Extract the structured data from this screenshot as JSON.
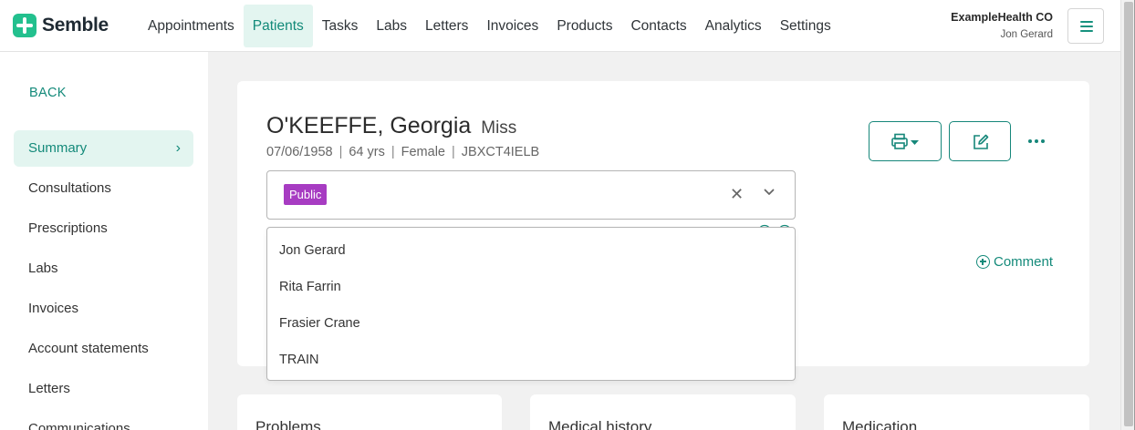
{
  "brand": {
    "name": "Semble",
    "accent": "#148a7a",
    "logo_color": "#23c08e"
  },
  "nav": {
    "items": [
      "Appointments",
      "Patients",
      "Tasks",
      "Labs",
      "Letters",
      "Invoices",
      "Products",
      "Contacts",
      "Analytics",
      "Settings"
    ],
    "active": "Patients"
  },
  "account": {
    "org": "ExampleHealth CO",
    "user": "Jon Gerard"
  },
  "sidebar": {
    "back_label": "BACK",
    "items": [
      {
        "label": "Summary",
        "active": true
      },
      {
        "label": "Consultations"
      },
      {
        "label": "Prescriptions"
      },
      {
        "label": "Labs"
      },
      {
        "label": "Invoices"
      },
      {
        "label": "Account statements"
      },
      {
        "label": "Letters"
      },
      {
        "label": "Communications"
      }
    ]
  },
  "patient": {
    "name": "O'KEEFFE, Georgia",
    "title": "Miss",
    "dob": "07/06/1958",
    "age": "64 yrs",
    "gender": "Female",
    "id": "JBXCT4IELB"
  },
  "tag_select": {
    "selected_tag": "Public",
    "tag_color": "#a73cc2",
    "options": [
      "Jon Gerard",
      "Rita Farrin",
      "Frasier Crane",
      "TRAIN"
    ]
  },
  "actions": {
    "print_icon": "printer-icon",
    "edit_icon": "edit-icon",
    "more_icon": "more-horizontal-icon",
    "comment_label": "Comment"
  },
  "cards": [
    "Problems",
    "Medical history",
    "Medication"
  ]
}
